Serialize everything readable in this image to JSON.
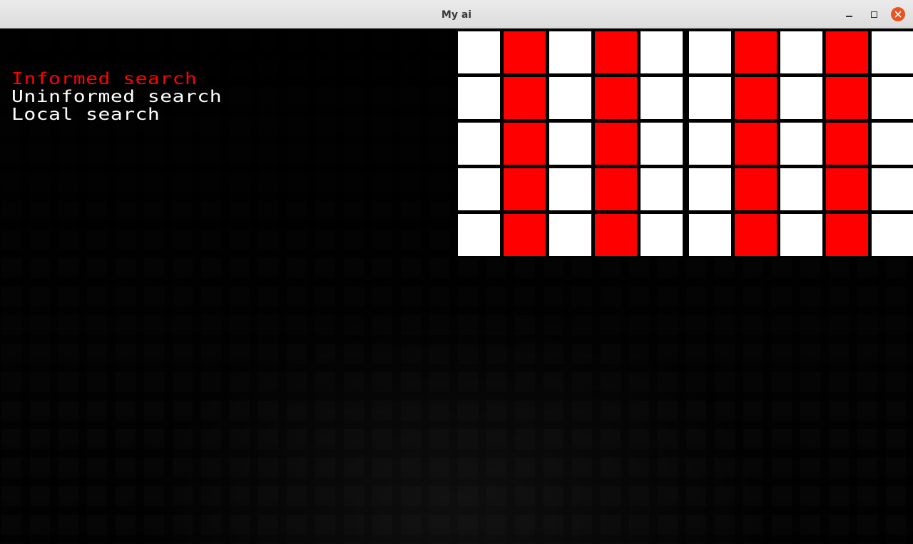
{
  "window": {
    "title": "My ai",
    "buttons": {
      "minimize": "minimize-icon",
      "maximize": "maximize-icon",
      "close": "close-icon"
    }
  },
  "menu": {
    "items": [
      {
        "label": "Informed search",
        "selected": true
      },
      {
        "label": "Uninformed search",
        "selected": false
      },
      {
        "label": "Local search",
        "selected": false
      }
    ],
    "selected_color": "#ff0000",
    "default_color": "#ffffff"
  },
  "grid": {
    "rows": 5,
    "cols": 10,
    "colors": {
      "W": "#ffffff",
      "R": "#ff0000"
    },
    "cells": [
      [
        "W",
        "R",
        "W",
        "R",
        "W",
        "W",
        "R",
        "W",
        "R",
        "W"
      ],
      [
        "W",
        "R",
        "W",
        "R",
        "W",
        "W",
        "R",
        "W",
        "R",
        "W"
      ],
      [
        "W",
        "R",
        "W",
        "R",
        "W",
        "W",
        "R",
        "W",
        "R",
        "W"
      ],
      [
        "W",
        "R",
        "W",
        "R",
        "W",
        "W",
        "R",
        "W",
        "R",
        "W"
      ],
      [
        "W",
        "R",
        "W",
        "R",
        "W",
        "W",
        "R",
        "W",
        "R",
        "W"
      ]
    ]
  }
}
